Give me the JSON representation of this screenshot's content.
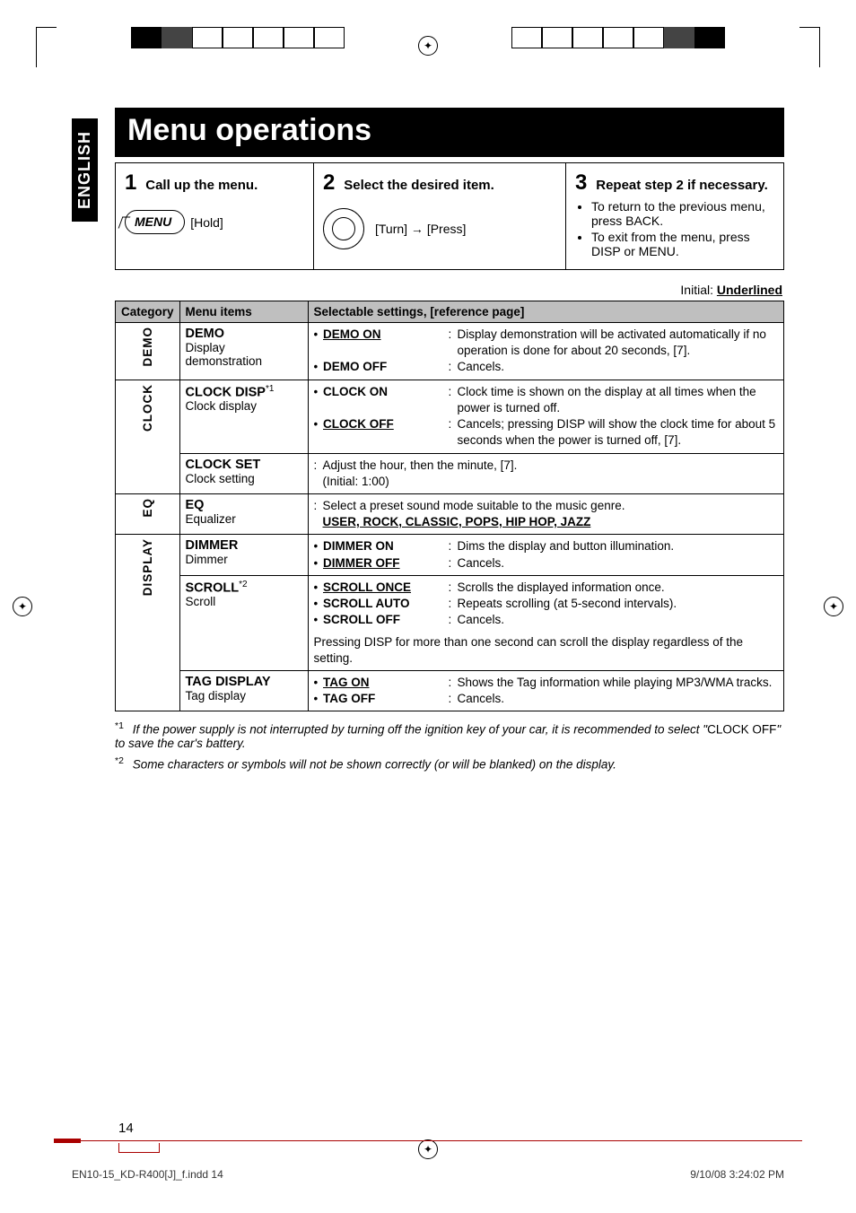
{
  "language_tab": "ENGLISH",
  "title": "Menu operations",
  "steps": {
    "s1": {
      "num": "1",
      "label": "Call up the menu.",
      "button_text": "MENU",
      "hold": "[Hold]"
    },
    "s2": {
      "num": "2",
      "label": "Select the desired item.",
      "knob_action": "[Turn] → [Press]"
    },
    "s3": {
      "num": "3",
      "label": "Repeat step 2 if necessary.",
      "bullets": [
        "To return to the previous menu, press BACK.",
        "To exit from the menu, press DISP or MENU."
      ]
    }
  },
  "initial_label_pre": "Initial: ",
  "initial_label_val": "Underlined",
  "table": {
    "headers": {
      "cat": "Category",
      "items": "Menu items",
      "settings": "Selectable settings, [reference page]"
    },
    "demo": {
      "cat": "DEMO",
      "item_title": "DEMO",
      "item_sub": "Display demonstration",
      "opt_on": "DEMO ON",
      "opt_on_desc": "Display demonstration will be activated automatically if no operation is done for about 20 seconds, [7].",
      "opt_off": "DEMO OFF",
      "opt_off_desc": "Cancels."
    },
    "clock": {
      "cat": "CLOCK",
      "disp_title": "CLOCK DISP",
      "disp_star": "*1",
      "disp_sub": "Clock display",
      "on": "CLOCK ON",
      "on_desc": "Clock time is shown on the display at all times when the power is turned off.",
      "off": "CLOCK OFF",
      "off_desc": "Cancels; pressing DISP will show the clock time for about 5 seconds when the power is turned off, [7].",
      "set_title": "CLOCK SET",
      "set_sub": "Clock setting",
      "set_desc": "Adjust the hour, then the minute, [7].",
      "set_initial": "(Initial: 1:00)"
    },
    "eq": {
      "cat": "EQ",
      "item_title": "EQ",
      "item_sub": "Equalizer",
      "desc": "Select a preset sound mode suitable to the music genre.",
      "modes": "USER, ROCK, CLASSIC, POPS, HIP HOP, JAZZ"
    },
    "display": {
      "cat": "DISPLAY",
      "dimmer_title": "DIMMER",
      "dimmer_sub": "Dimmer",
      "dim_on": "DIMMER ON",
      "dim_on_desc": "Dims the display and button illumination.",
      "dim_off": "DIMMER OFF",
      "dim_off_desc": "Cancels.",
      "scroll_title": "SCROLL",
      "scroll_star": "*2",
      "scroll_sub": "Scroll",
      "scroll_once": "SCROLL ONCE",
      "scroll_once_desc": "Scrolls the displayed information once.",
      "scroll_auto": "SCROLL AUTO",
      "scroll_auto_desc": "Repeats scrolling (at 5-second intervals).",
      "scroll_off": "SCROLL OFF",
      "scroll_off_desc": "Cancels.",
      "scroll_note": "Pressing DISP for more than one second can scroll the display regardless of the setting.",
      "tag_title": "TAG DISPLAY",
      "tag_sub": "Tag display",
      "tag_on": "TAG ON",
      "tag_on_desc": "Shows the Tag information while playing MP3/WMA tracks.",
      "tag_off": "TAG OFF",
      "tag_off_desc": "Cancels."
    }
  },
  "footnotes": {
    "f1_mark": "*1",
    "f1_a": "If the power supply is not interrupted by turning off the ignition key of your car, it is recommended to select \"",
    "f1_b": "CLOCK OFF",
    "f1_c": "\" to save the car's battery.",
    "f2_mark": "*2",
    "f2": "Some characters or symbols will not be shown correctly (or will be blanked) on the display."
  },
  "page_number": "14",
  "footer_left": "EN10-15_KD-R400[J]_f.indd   14",
  "footer_right": "9/10/08   3:24:02 PM"
}
